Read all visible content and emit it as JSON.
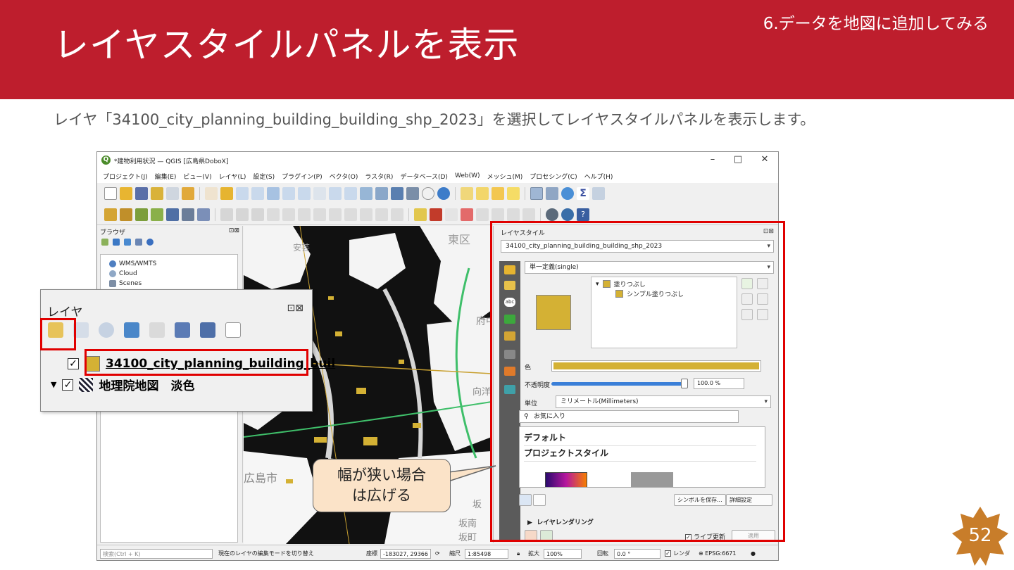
{
  "slide": {
    "title": "レイヤスタイルパネルを表示",
    "section": "6.データを地図に追加してみる",
    "description": "レイヤ「34100_city_planning_building_building_shp_2023」を選択してレイヤスタイルパネルを表示します。",
    "page_number": "52",
    "callout_line1": "幅が狭い場合",
    "callout_line2": "は広げる",
    "colors": {
      "header": "#be1e2d",
      "highlight": "#e00000",
      "badge": "#c87d2a",
      "callout": "#fbe3c8"
    }
  },
  "qgis": {
    "window_title": "*建物利用状況 — QGIS [広島県DoboX]",
    "app_icon": "Q",
    "minimize": "–",
    "maximize": "□",
    "close": "✕",
    "menu": [
      "プロジェクト(J)",
      "編集(E)",
      "ビュー(V)",
      "レイヤ(L)",
      "設定(S)",
      "プラグイン(P)",
      "ベクタ(O)",
      "ラスタ(R)",
      "データベース(D)",
      "Web(W)",
      "メッシュ(M)",
      "プロセシング(C)",
      "ヘルプ(H)"
    ],
    "browser": {
      "title": "ブラウザ",
      "controls": "⊡⊠",
      "items": [
        "WMS/WMTS",
        "Cloud",
        "Scenes"
      ]
    },
    "map": {
      "labels": [
        "東区",
        "安芸",
        "府中町",
        "広島市",
        "向洋",
        "坂",
        "坂南",
        "坂町"
      ]
    },
    "status": {
      "search_placeholder": "検索(Ctrl + K)",
      "message": "現在のレイヤの編集モードを切り替え",
      "coord_label": "座標",
      "coord_value": "-183027, 29366",
      "scale_label": "縮尺",
      "scale_value": "1:85498",
      "magnifier_label": "拡大",
      "magnifier_value": "100%",
      "rotation_label": "回転",
      "rotation_value": "0.0 °",
      "render_label": "レンダ",
      "crs": "EPSG:6671"
    },
    "style_panel": {
      "title": "レイヤスタイル",
      "controls": "⊡⊠",
      "layer_combo": "34100_city_planning_building_building_shp_2023",
      "renderer_combo": "単一定義(single)",
      "tree_fill": "塗りつぶし",
      "tree_simple_fill": "シンプル塗りつぶし",
      "color_label": "色",
      "opacity_label": "不透明度",
      "opacity_value": "100.0 %",
      "unit_label": "単位",
      "unit_value": "ミリメートル(Millimeters)",
      "search_placeholder": "お気に入り",
      "lib_default": "デフォルト",
      "lib_project": "プロジェクトスタイル",
      "save_symbol": "シンボルを保存...",
      "advanced": "詳細設定",
      "layer_rendering": "レイヤレンダリング",
      "live_update": "ライブ更新",
      "apply": "適用",
      "tab_abc": "abc"
    }
  },
  "layers_zoom": {
    "title": "レイヤ",
    "controls": "⊡⊠",
    "layer1": "34100_city_planning_building_buil",
    "layer2": "地理院地図　淡色",
    "check": "✓"
  }
}
